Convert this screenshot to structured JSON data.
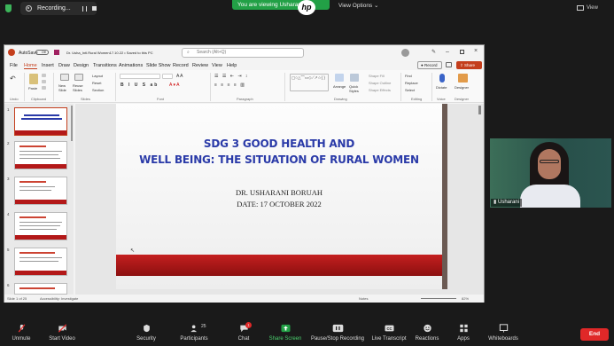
{
  "zoom": {
    "recording_label": "Recording...",
    "banner_text": "You are viewing Usharani",
    "view_options_label": "View Options",
    "view_label": "View",
    "participants_count": "25",
    "chat_badge": "1",
    "toolbar": {
      "unmute": "Unmute",
      "start_video": "Start Video",
      "security": "Security",
      "participants": "Participants",
      "chat": "Chat",
      "share_screen": "Share Screen",
      "pause_stop_recording": "Pause/Stop Recording",
      "live_transcript": "Live Transcript",
      "reactions": "Reactions",
      "apps": "Apps",
      "whiteboards": "Whiteboards",
      "end": "End"
    },
    "video_name": "Usharani"
  },
  "ppt": {
    "autosave": "AutoSave",
    "toggle_state": "Off",
    "file_title": "Dr. Usha_Intl.Rural Women17.10.22 • Saved to this PC",
    "search_placeholder": "Search (Alt+Q)",
    "menu": [
      "File",
      "Home",
      "Insert",
      "Draw",
      "Design",
      "Transitions",
      "Animations",
      "Slide Show",
      "Record",
      "Review",
      "View",
      "Help"
    ],
    "record_btn": "Record",
    "share_btn": "Share",
    "ribbon_groups": [
      "Undo",
      "Clipboard",
      "Slides",
      "Font",
      "Paragraph",
      "Drawing",
      "Editing",
      "Voice",
      "Designer"
    ],
    "ribbon": {
      "paste": "Paste",
      "new_slide": "New Slide",
      "reuse_slides": "Reuse Slides",
      "layout": "Layout",
      "reset": "Reset",
      "section": "Section",
      "arrange": "Arrange",
      "quick_styles": "Quick Styles",
      "shape_fill": "Shape Fill",
      "shape_outline": "Shape Outline",
      "shape_effects": "Shape Effects",
      "find": "Find",
      "replace": "Replace",
      "select": "Select",
      "dictate": "Dictate",
      "designer": "Designer"
    },
    "slide_numbers": [
      "1",
      "2",
      "3",
      "4",
      "5",
      "6"
    ],
    "slide": {
      "title_line1": "SDG 3 GOOD HEALTH AND",
      "title_line2": "WELL BEING: THE SITUATION OF RURAL WOMEN",
      "author": "DR. USHARANI BORUAH",
      "date": "DATE: 17 OCTOBER 2022"
    },
    "status": {
      "slide_of": "Slide 1 of 25",
      "accessibility": "Accessibility: Investigate",
      "notes": "Notes",
      "zoom": "82%"
    }
  },
  "colors": {
    "accent_red": "#c43e1c",
    "title_blue": "#2a3aa8",
    "zoom_green": "#22a046",
    "end_red": "#e02828"
  }
}
